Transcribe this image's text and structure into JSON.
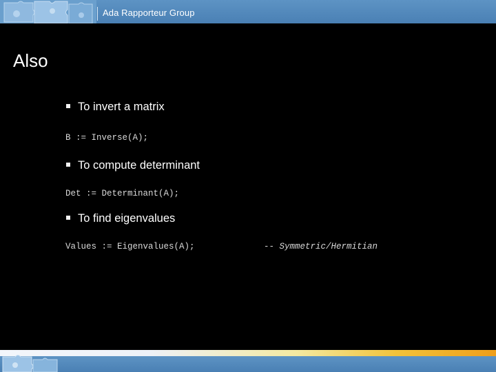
{
  "header": {
    "text": "Ada Rapporteur Group"
  },
  "slide": {
    "title": "Also",
    "items": [
      {
        "bullet": "To invert a matrix",
        "code": "B := Inverse(A);"
      },
      {
        "bullet": "To compute determinant",
        "code": "Det := Determinant(A);"
      },
      {
        "bullet": "To find eigenvalues",
        "code": "Values := Eigenvalues(A);",
        "comment": "-- Symmetric/Hermitian"
      }
    ]
  },
  "colors": {
    "header_blue": "#4a80b4",
    "background": "#000000",
    "text": "#ffffff",
    "footer_accent": "#f2c23a"
  },
  "icons": {
    "header_decoration": "puzzle-pieces",
    "footer_decoration": "puzzle-pieces",
    "bullet": "square-bullet"
  }
}
